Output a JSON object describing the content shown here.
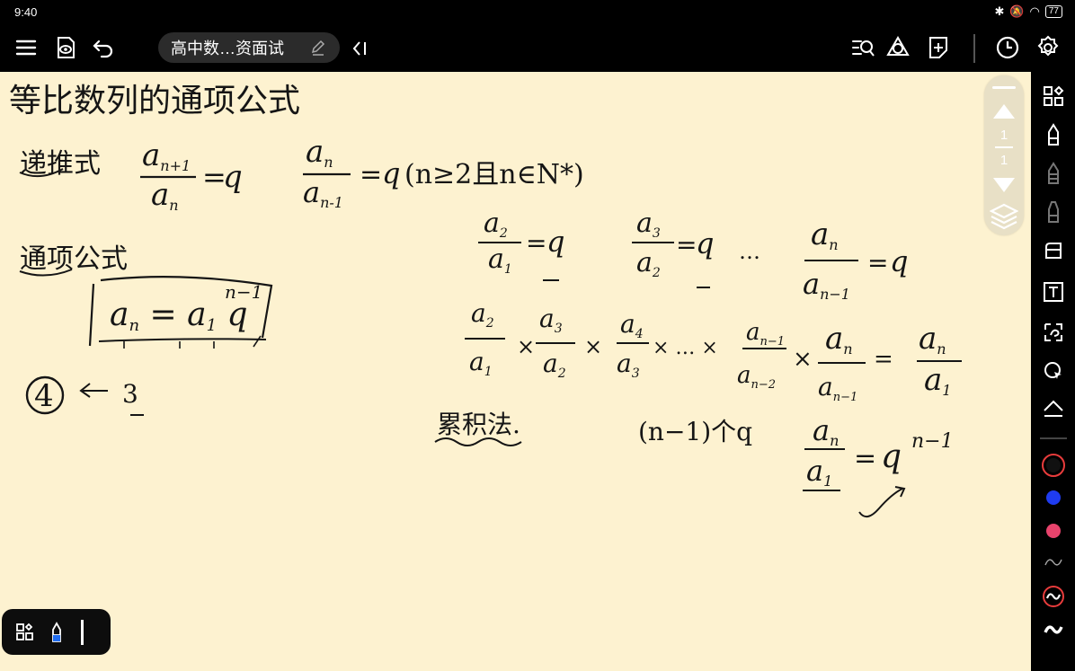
{
  "status_bar": {
    "time": "9:40",
    "battery": "77"
  },
  "toolbar": {
    "doc_title": "高中数…资面试",
    "icons": [
      "menu-icon",
      "read-mode-icon",
      "undo-icon",
      "edit-icon",
      "collapse-icon",
      "search-list-icon",
      "shapes-icon",
      "add-page-icon",
      "history-icon",
      "settings-icon"
    ]
  },
  "page_indicator": {
    "current": "1",
    "total": "1"
  },
  "sidebar": {
    "tools": [
      "layout-icon",
      "pen-icon",
      "pencil-icon",
      "marker-icon",
      "eraser-icon",
      "text-icon",
      "lasso-icon",
      "laser-icon",
      "shape-icon"
    ],
    "colors": [
      "#111111",
      "#1f3cf0",
      "#e8436c"
    ],
    "stroke_styles": [
      "thin-stroke-icon",
      "medium-stroke-icon",
      "thick-stroke-icon"
    ]
  },
  "notes": {
    "title": "等比数列的通项公式",
    "recursive_label": "递推式",
    "general_label": "通项公式",
    "circled_number": "4",
    "arrow_value": "3",
    "cumulative_label": "累积法.",
    "condition": "(n≥2且n∈N*)",
    "count_note": "(n−1)个q",
    "exponent": "n−1",
    "q": "q",
    "dots": "…"
  },
  "mini_panel": {
    "icons": [
      "layout-icon",
      "pen-icon",
      "cursor-icon"
    ]
  }
}
